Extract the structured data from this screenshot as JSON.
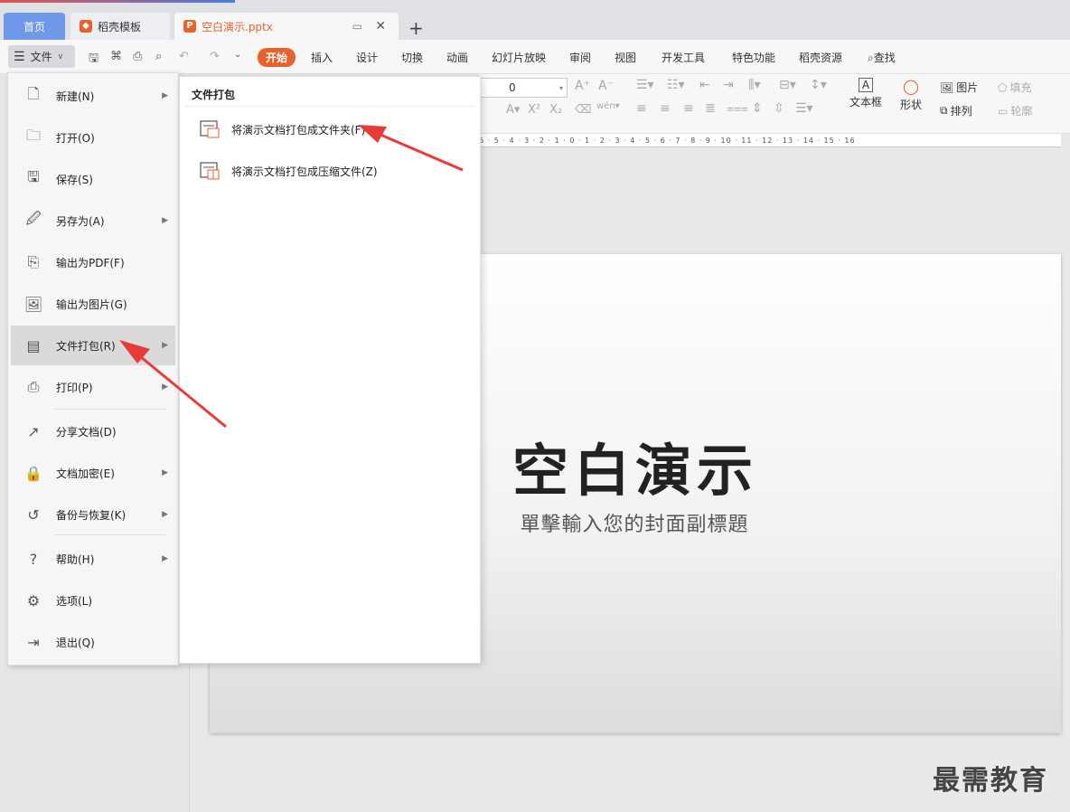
{
  "tabs": {
    "home": "首页",
    "template": "稻壳模板",
    "document": "空白演示.pptx"
  },
  "toolbar": {
    "file_label": "文件",
    "menu_tabs": [
      "开始",
      "插入",
      "设计",
      "切换",
      "动画",
      "幻灯片放映",
      "审阅",
      "视图",
      "开发工具",
      "特色功能",
      "稻壳资源",
      "查找"
    ]
  },
  "format": {
    "font_size": "0",
    "textbox": "文本框",
    "shape": "形状",
    "picture": "图片",
    "arrange": "排列",
    "fill": "填充",
    "outline": "轮廓"
  },
  "ruler_text": "6 · 5 · 4 · 3 · 2 · 1 · 0 · 1 · 2 · 3 · 4 · 5 · 6 · 7 · 8 · 9 · 10 · 11 · 12 · 13 · 14 · 15 · 16",
  "file_menu": {
    "items": [
      {
        "label": "新建(N)",
        "icon": "new-file-icon"
      },
      {
        "label": "打开(O)",
        "icon": "folder-icon"
      },
      {
        "label": "保存(S)",
        "icon": "save-icon"
      },
      {
        "label": "另存为(A)",
        "icon": "save-as-icon"
      },
      {
        "label": "输出为PDF(F)",
        "icon": "pdf-icon"
      },
      {
        "label": "输出为图片(G)",
        "icon": "image-icon"
      },
      {
        "label": "文件打包(R)",
        "icon": "package-icon"
      },
      {
        "label": "打印(P)",
        "icon": "print-icon"
      },
      {
        "label": "分享文档(D)",
        "icon": "share-icon"
      },
      {
        "label": "文档加密(E)",
        "icon": "encrypt-icon"
      },
      {
        "label": "备份与恢复(K)",
        "icon": "backup-icon"
      },
      {
        "label": "帮助(H)",
        "icon": "help-icon"
      },
      {
        "label": "选项(L)",
        "icon": "gear-icon"
      },
      {
        "label": "退出(Q)",
        "icon": "exit-icon"
      }
    ]
  },
  "submenu": {
    "title": "文件打包",
    "items": [
      "将演示文档打包成文件夹(F)",
      "将演示文档打包成压缩文件(Z)"
    ]
  },
  "slide": {
    "title": "空白演示",
    "subtitle": "單擊輸入您的封面副標題"
  },
  "watermark": "最需教育",
  "colors": {
    "accent": "#e8612c",
    "home_tab": "#6f98e8",
    "arrow": "#e83a36"
  }
}
